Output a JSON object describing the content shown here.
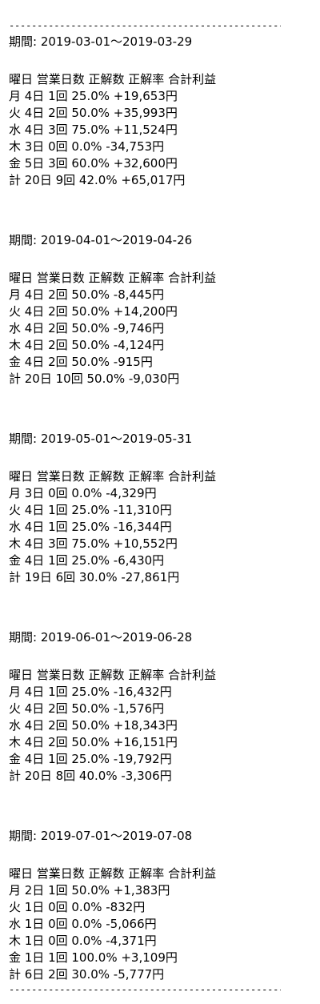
{
  "divider": "----------------------------------------------------",
  "sections": [
    {
      "period": "期間: 2019-03-01〜2019-03-29",
      "header": "曜日 営業日数 正解数 正解率 合計利益",
      "rows": [
        "月 4日 1回 25.0% +19,653円",
        "火 4日 2回 50.0% +35,993円",
        "水 4日 3回 75.0% +11,524円",
        "木 3日 0回 0.0% -34,753円",
        "金 5日 3回 60.0% +32,600円",
        "計 20日 9回 42.0% +65,017円"
      ]
    },
    {
      "period": "期間: 2019-04-01〜2019-04-26",
      "header": "曜日 営業日数 正解数 正解率 合計利益",
      "rows": [
        "月 4日 2回 50.0% -8,445円",
        "火 4日 2回 50.0% +14,200円",
        "水 4日 2回 50.0% -9,746円",
        "木 4日 2回 50.0% -4,124円",
        "金 4日 2回 50.0% -915円",
        "計 20日 10回 50.0% -9,030円"
      ]
    },
    {
      "period": "期間: 2019-05-01〜2019-05-31",
      "header": "曜日 営業日数 正解数 正解率 合計利益",
      "rows": [
        "月 3日 0回 0.0% -4,329円",
        "火 4日 1回 25.0% -11,310円",
        "水 4日 1回 25.0% -16,344円",
        "木 4日 3回 75.0% +10,552円",
        "金 4日 1回 25.0% -6,430円",
        "計 19日 6回 30.0% -27,861円"
      ]
    },
    {
      "period": "期間: 2019-06-01〜2019-06-28",
      "header": "曜日 営業日数 正解数 正解率 合計利益",
      "rows": [
        "月 4日 1回 25.0% -16,432円",
        "火 4日 2回 50.0% -1,576円",
        "水 4日 2回 50.0% +18,343円",
        "木 4日 2回 50.0% +16,151円",
        "金 4日 1回 25.0% -19,792円",
        "計 20日 8回 40.0% -3,306円"
      ]
    },
    {
      "period": "期間: 2019-07-01〜2019-07-08",
      "header": "曜日 営業日数 正解数 正解率 合計利益",
      "rows": [
        "月 2日 1回 50.0% +1,383円",
        "火 1日 0回 0.0% -832円",
        "水 1日 0回 0.0% -5,066円",
        "木 1日 0回 0.0% -4,371円",
        "金 1日 1回 100.0% +3,109円",
        "計 6日 2回 30.0% -5,777円"
      ]
    }
  ]
}
